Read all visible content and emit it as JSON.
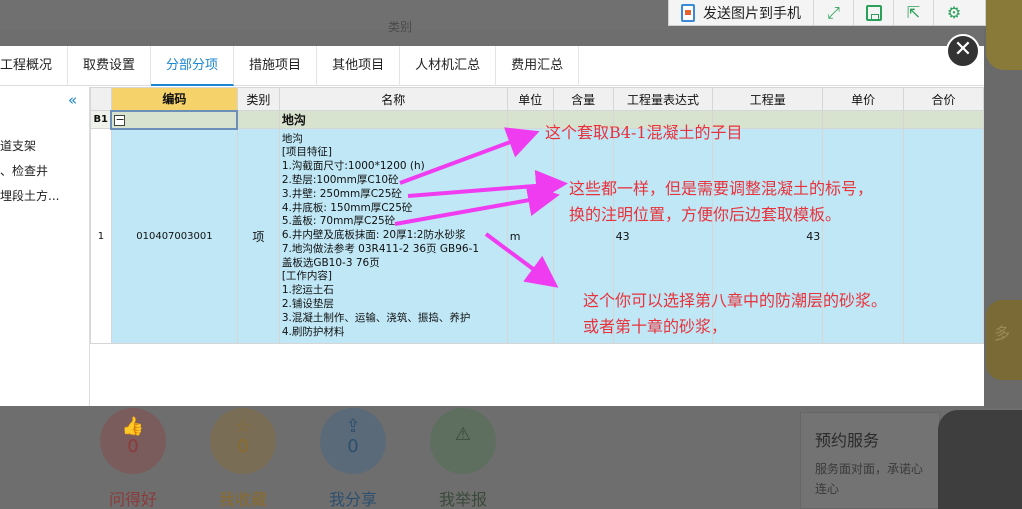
{
  "background": {
    "top_label": "类别",
    "actions": [
      {
        "icon": "thumbs-up-icon",
        "count": "0",
        "label": "问得好"
      },
      {
        "icon": "star-icon",
        "count": "0",
        "label": "我收藏"
      },
      {
        "icon": "share-icon",
        "count": "0",
        "label": "我分享"
      },
      {
        "icon": "warning-icon",
        "count": "",
        "label": "我举报"
      }
    ],
    "service": {
      "title": "预约服务",
      "desc": "服务面对面，承诺心连心"
    },
    "side_text": "多"
  },
  "phone_toolbar": {
    "send_label": "发送图片到手机",
    "icons": [
      "expand-icon",
      "save-icon",
      "export-icon",
      "settings-icon"
    ]
  },
  "tabs": [
    {
      "label": "工程概况",
      "active": false
    },
    {
      "label": "取费设置",
      "active": false
    },
    {
      "label": "分部分项",
      "active": true
    },
    {
      "label": "措施项目",
      "active": false
    },
    {
      "label": "其他项目",
      "active": false
    },
    {
      "label": "人材机汇总",
      "active": false
    },
    {
      "label": "费用汇总",
      "active": false
    }
  ],
  "sidebar": {
    "collapse_icon": "«",
    "items": [
      "道支架",
      "、检查井",
      "埋段土方..."
    ]
  },
  "grid": {
    "headers": [
      "编码",
      "类别",
      "名称",
      "单位",
      "含量",
      "工程量表达式",
      "工程量",
      "单价",
      "合价"
    ],
    "group_row": {
      "row_label": "B1",
      "expander": "−",
      "name": "地沟"
    },
    "item_row": {
      "row_label": "1",
      "code": "010407003001",
      "type": "项",
      "unit": "m",
      "quantity_expr": "43",
      "quantity": "43",
      "name_lines": [
        "地沟",
        "[项目特征]",
        "1.沟截面尺寸:1000*1200 (h)",
        "2.垫层:100mm厚C10砼",
        "3.井壁: 250mm厚C25砼",
        "4.井底板: 150mm厚C25砼",
        "5.盖板: 70mm厚C25砼",
        "6.井内壁及底板抹面: 20厚1:2防水砂浆",
        "7.地沟做法参考  03R411-2  36页 GB96-1",
        "盖板选GB10-3 76页",
        "[工作内容]",
        "1.挖运土石",
        "2.铺设垫层",
        "3.混凝土制作、运输、浇筑、振捣、养护",
        "4.刷防护材料"
      ]
    }
  },
  "close_label": "✕",
  "annotations": [
    {
      "lines": [
        "这个套取B4-1混凝土的子目"
      ]
    },
    {
      "lines": [
        "这些都一样，但是需要调整混凝土的标号，",
        "换的注明位置，方便你后边套取模板。"
      ]
    },
    {
      "lines": [
        "这个你可以选择第八章中的防潮层的砂浆。",
        "或者第十章的砂浆，"
      ]
    }
  ],
  "colors": {
    "annotation": "#e8333c",
    "arrow": "#f03cf0",
    "active_tab": "#1a86d0",
    "row_highlight": "#bfe7f5"
  }
}
